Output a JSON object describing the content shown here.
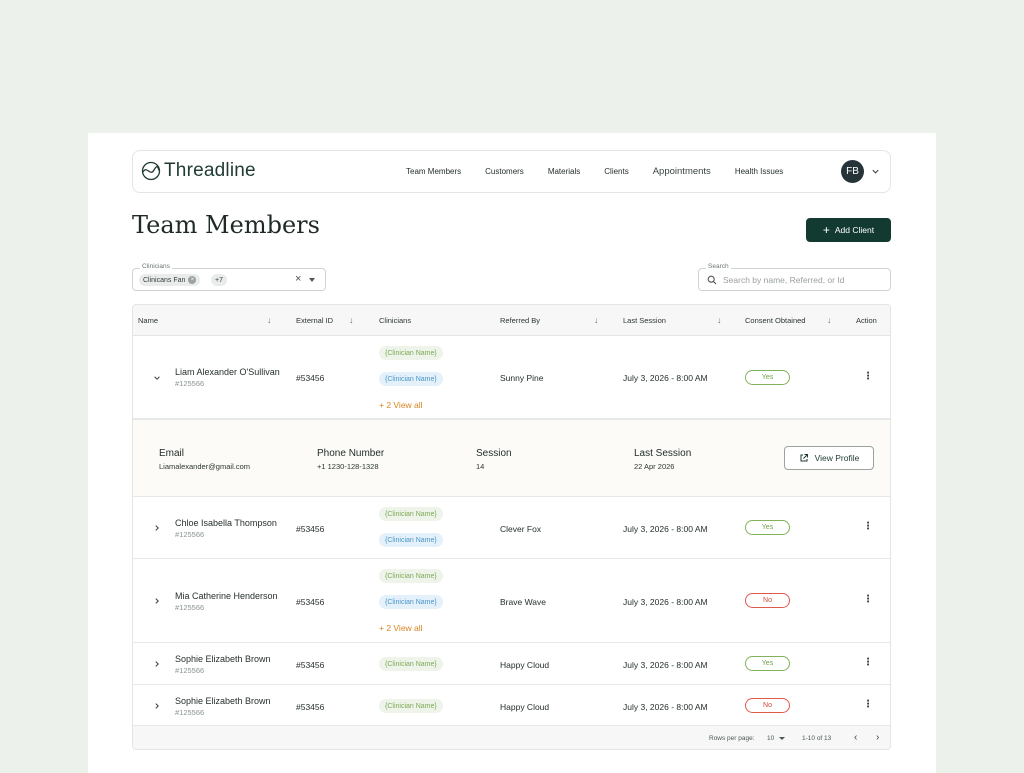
{
  "app": {
    "brand": "Threadline",
    "nav": [
      "Team Members",
      "Customers",
      "Materials",
      "Clients",
      "Appointments",
      "Health Issues"
    ],
    "avatar_initials": "FB"
  },
  "page": {
    "title": "Team Members",
    "add_button": "Add Client"
  },
  "filter": {
    "label": "Clinicians",
    "chip": "Clinicans Fan",
    "more_chip": "+7"
  },
  "search": {
    "label": "Search",
    "placeholder": "Search by name, Referred, or Id"
  },
  "table": {
    "columns": [
      "Name",
      "External ID",
      "Clinicians",
      "Referred By",
      "Last Session",
      "Consent Obtained",
      "Action"
    ],
    "rows": [
      {
        "name": "Liam Alexander O'Sullivan",
        "id": "#125566",
        "external_id": "#53456",
        "clinicians": [
          "{Clinician Name}",
          "{Clinician Name}"
        ],
        "more": "+ 2  View all",
        "referred_by": "Sunny Pine",
        "last_session": "July 3, 2026 - 8:00 AM",
        "consent": "Yes"
      },
      {
        "name": "Chloe Isabella Thompson",
        "id": "#125566",
        "external_id": "#53456",
        "clinicians": [
          "{Clinician Name}",
          "{Clinician Name}"
        ],
        "more": "",
        "referred_by": "Clever Fox",
        "last_session": "July 3, 2026 - 8:00 AM",
        "consent": "Yes"
      },
      {
        "name": "Mia Catherine Henderson",
        "id": "#125566",
        "external_id": "#53456",
        "clinicians": [
          "{Clinician Name}",
          "{Clinician Name}"
        ],
        "more": "+ 2  View all",
        "referred_by": "Brave Wave",
        "last_session": "July 3, 2026 - 8:00 AM",
        "consent": "No"
      },
      {
        "name": "Sophie Elizabeth Brown",
        "id": "#125566",
        "external_id": "#53456",
        "clinicians": [
          "{Clinician Name}"
        ],
        "more": "",
        "referred_by": "Happy Cloud",
        "last_session": "July 3, 2026 - 8:00 AM",
        "consent": "Yes"
      },
      {
        "name": "Sophie Elizabeth Brown",
        "id": "#125566",
        "external_id": "#53456",
        "clinicians": [
          "{Clinician Name}"
        ],
        "more": "",
        "referred_by": "Happy Cloud",
        "last_session": "July 3, 2026 - 8:00 AM",
        "consent": "No"
      }
    ],
    "detail": {
      "email_label": "Email",
      "email": "Liamalexander@gmail.com",
      "phone_label": "Phone Number",
      "phone": "+1 1230-128-1328",
      "session_label": "Session",
      "session": "14",
      "last_session_label": "Last Session",
      "last_session": "22 Apr 2026",
      "view_profile": "View Profile"
    }
  },
  "pagination": {
    "rows_per_page_label": "Rows per page:",
    "rows_per_page": "10",
    "range": "1-10 of 13"
  },
  "colors": {
    "primary": "#133a31",
    "yes": "#6ea24a",
    "no": "#d3483a",
    "link": "#d98520"
  }
}
